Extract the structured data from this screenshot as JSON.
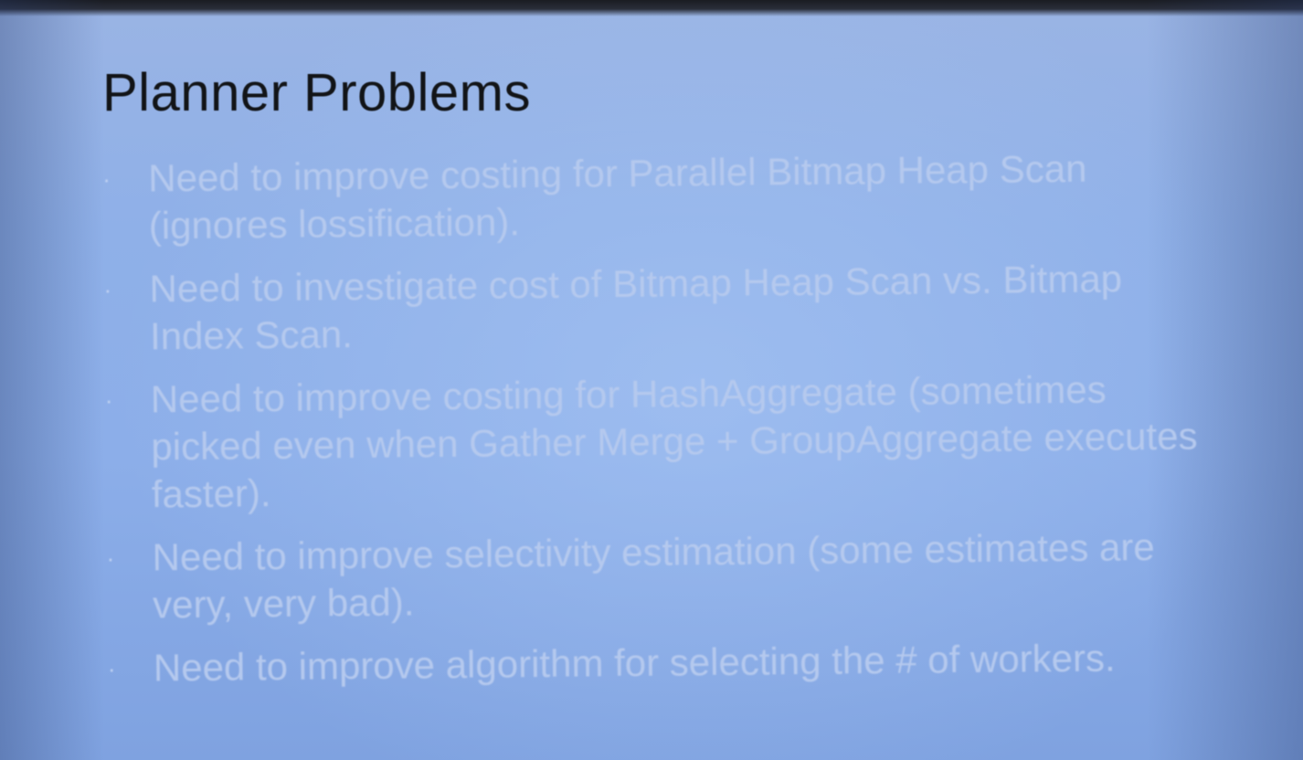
{
  "slide": {
    "title": "Planner Problems",
    "bullet_symbol": "·",
    "bullets": [
      "Need to improve costing for Parallel Bitmap Heap Scan (ignores lossification).",
      "Need to investigate cost of Bitmap Heap Scan vs. Bitmap Index Scan.",
      "Need to improve costing for HashAggregate (sometimes picked even when Gather Merge + GroupAggregate executes faster).",
      "Need to improve selectivity estimation (some estimates are very, very bad).",
      "Need to improve algorithm for selecting the # of workers."
    ]
  },
  "colors": {
    "background": "#8caee9",
    "title_text": "#121417",
    "bullet_text": "#b5c9ee"
  }
}
